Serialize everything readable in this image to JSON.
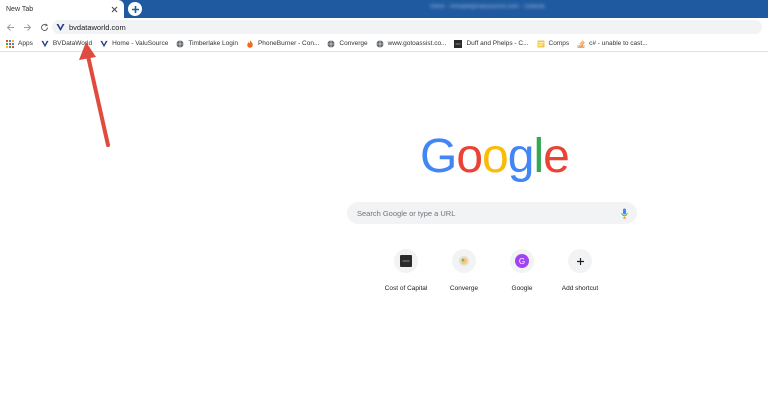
{
  "tab": {
    "title": "New Tab",
    "close_glyph": "✕",
    "newtab_glyph": "+"
  },
  "toolbar": {
    "back_icon": "back-arrow-icon",
    "forward_icon": "forward-arrow-icon",
    "reload_icon": "reload-icon",
    "url": "bvdataworld.com"
  },
  "profile": {
    "text": "Inbox - mmaieli@valusource.com  ·  Outlook"
  },
  "bookmarks": [
    {
      "label": "Apps",
      "icon": "apps-grid-icon"
    },
    {
      "label": "BVDataWorld",
      "icon": "v-logo-icon"
    },
    {
      "label": "Home - ValuSource",
      "icon": "v-logo-icon"
    },
    {
      "label": "Timberlake Login",
      "icon": "globe-icon"
    },
    {
      "label": "PhoneBurner - Con...",
      "icon": "flame-icon"
    },
    {
      "label": "Converge",
      "icon": "globe-icon"
    },
    {
      "label": "www.gotoassist.co...",
      "icon": "globe-icon"
    },
    {
      "label": "Duff and Phelps - C...",
      "icon": "dark-square-icon"
    },
    {
      "label": "Comps",
      "icon": "folder-icon"
    },
    {
      "label": "c# - unable to cast...",
      "icon": "stack-icon"
    }
  ],
  "logo": {
    "letters": [
      "G",
      "o",
      "o",
      "g",
      "l",
      "e"
    ],
    "colors": [
      "#4285F4",
      "#EA4335",
      "#FBBC05",
      "#4285F4",
      "#34A853",
      "#EA4335"
    ]
  },
  "search": {
    "placeholder": "Search Google or type a URL"
  },
  "shortcuts": [
    {
      "label": "Cost of Capital",
      "icon": "dark-tile-icon"
    },
    {
      "label": "Converge",
      "icon": "converge-icon"
    },
    {
      "label": "Google",
      "icon": "letter-g-icon",
      "letter": "G"
    },
    {
      "label": "Add shortcut",
      "icon": "plus-icon",
      "glyph": "+"
    }
  ],
  "colors": {
    "tabstrip": "#1f5aa0",
    "arrow": "#e04a3f",
    "omnibox": "#f1f3f4"
  }
}
